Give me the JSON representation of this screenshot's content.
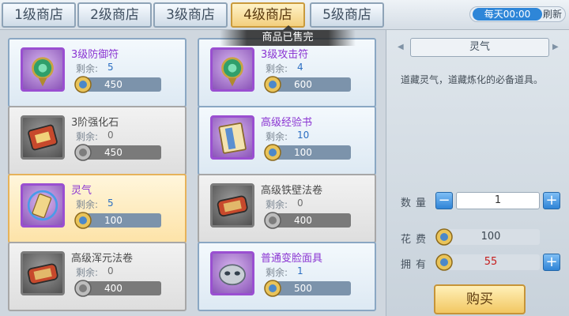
{
  "tabs": [
    {
      "label": "1级商店",
      "active": false
    },
    {
      "label": "2级商店",
      "active": false
    },
    {
      "label": "3级商店",
      "active": false
    },
    {
      "label": "4级商店",
      "active": true
    },
    {
      "label": "5级商店",
      "active": false
    }
  ],
  "refresh": {
    "time": "每天00:00",
    "label": "刷新"
  },
  "banner": {
    "sold_out": "商品已售完"
  },
  "items": [
    {
      "name": "3级防御符",
      "remain_label": "剩余:",
      "remain": "5",
      "price": "450",
      "rarity": "purple",
      "sold_out": false,
      "selected": false,
      "icon": "amulet-icon"
    },
    {
      "name": "3级攻击符",
      "remain_label": "剩余:",
      "remain": "4",
      "price": "600",
      "rarity": "purple",
      "sold_out": false,
      "selected": false,
      "icon": "amulet-icon"
    },
    {
      "name": "3阶强化石",
      "remain_label": "剩余:",
      "remain": "0",
      "price": "450",
      "rarity": "gray",
      "sold_out": true,
      "selected": false,
      "icon": "stone-icon"
    },
    {
      "name": "高级经验书",
      "remain_label": "剩余:",
      "remain": "10",
      "price": "100",
      "rarity": "purple",
      "sold_out": false,
      "selected": false,
      "icon": "book-icon"
    },
    {
      "name": "灵气",
      "remain_label": "剩余:",
      "remain": "5",
      "price": "100",
      "rarity": "purple",
      "sold_out": false,
      "selected": true,
      "icon": "talisman-icon"
    },
    {
      "name": "高级铁壁法卷",
      "remain_label": "剩余:",
      "remain": "0",
      "price": "400",
      "rarity": "gray",
      "sold_out": true,
      "selected": false,
      "icon": "scroll-icon"
    },
    {
      "name": "高级浑元法卷",
      "remain_label": "剩余:",
      "remain": "0",
      "price": "400",
      "rarity": "gray",
      "sold_out": true,
      "selected": false,
      "icon": "scroll-icon"
    },
    {
      "name": "普通变脸面具",
      "remain_label": "剩余:",
      "remain": "1",
      "price": "500",
      "rarity": "purple",
      "sold_out": false,
      "selected": false,
      "icon": "mask-icon"
    }
  ],
  "detail": {
    "title": "灵气",
    "description": "道藏灵气，道藏炼化的必备道具。",
    "qty_label": "数量",
    "qty_value": "1",
    "cost_label": "花费",
    "cost_value": "100",
    "own_label": "拥有",
    "own_value": "55",
    "buy_label": "购买"
  },
  "colors": {
    "tab_active": "#f3cf7e",
    "purple_name": "#8a34d2",
    "remain_value": "#2b6ec2",
    "own_value": "#c61d1d",
    "refresh_badge": "#2e86d8"
  }
}
